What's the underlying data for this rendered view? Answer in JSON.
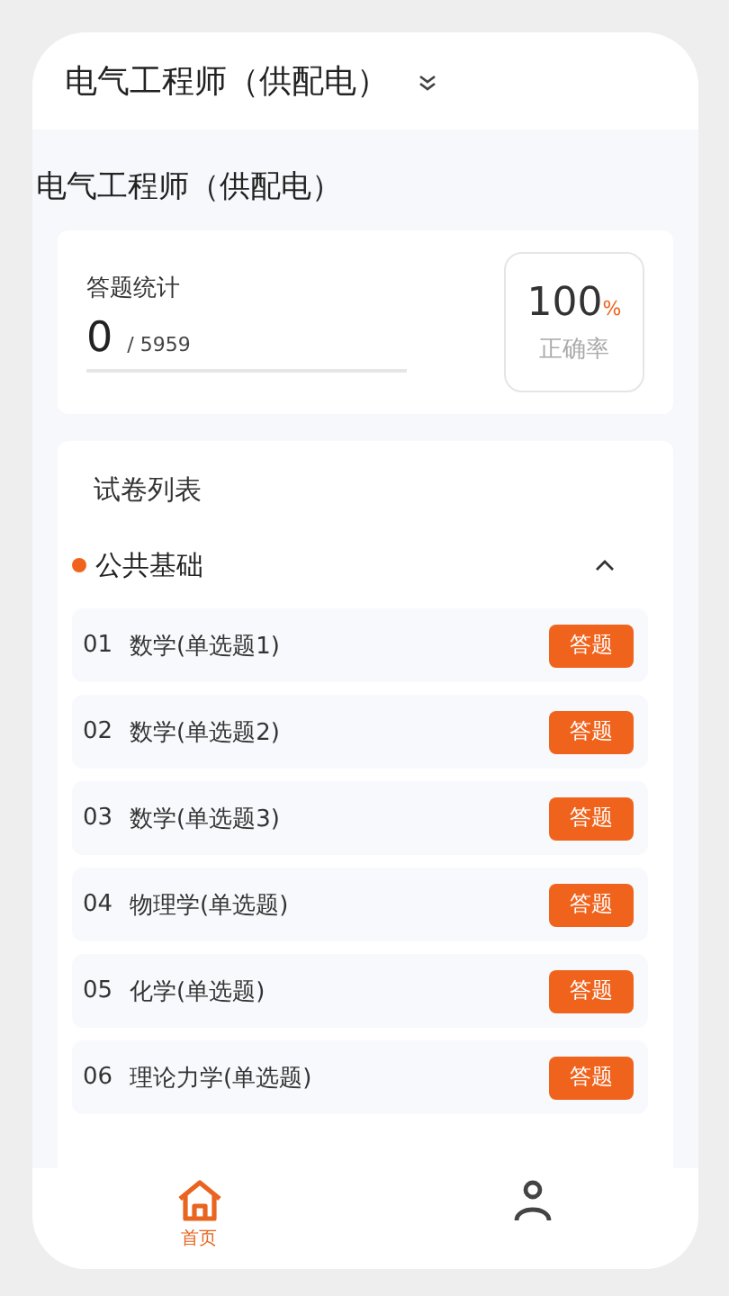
{
  "header": {
    "title": "电气工程师（供配电）"
  },
  "page_title": "电气工程师（供配电）",
  "stats": {
    "label": "答题统计",
    "answered": "0",
    "total": "/ 5959",
    "accuracy": "100",
    "accuracy_unit": "%",
    "accuracy_label": "正确率"
  },
  "paper_list": {
    "title": "试卷列表",
    "section": {
      "name": "公共基础",
      "color": "#f0631c",
      "expanded": true
    },
    "papers": [
      {
        "number": "01",
        "name": "数学(单选题1)",
        "action": "答题"
      },
      {
        "number": "02",
        "name": "数学(单选题2)",
        "action": "答题"
      },
      {
        "number": "03",
        "name": "数学(单选题3)",
        "action": "答题"
      },
      {
        "number": "04",
        "name": "物理学(单选题)",
        "action": "答题"
      },
      {
        "number": "05",
        "name": "化学(单选题)",
        "action": "答题"
      },
      {
        "number": "06",
        "name": "理论力学(单选题)",
        "action": "答题"
      }
    ]
  },
  "bottom_nav": [
    {
      "kind": "home",
      "label": "首页",
      "selected": true
    },
    {
      "kind": "person",
      "selected": false
    }
  ]
}
